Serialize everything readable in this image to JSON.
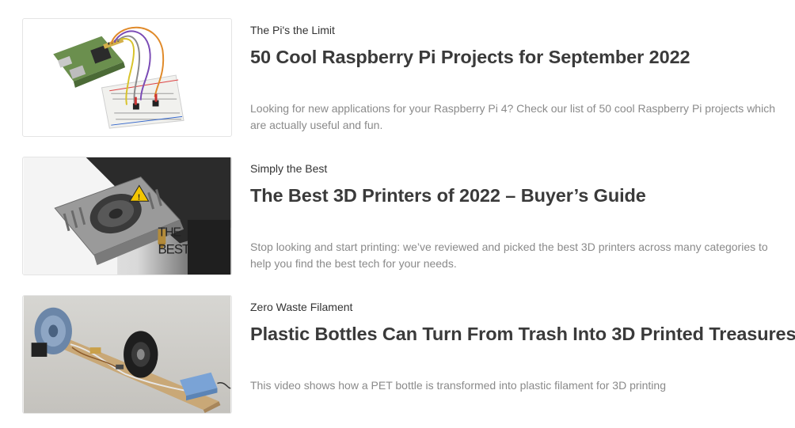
{
  "articles": [
    {
      "kicker": "The Pi's the Limit",
      "title": "50 Cool Raspberry Pi Projects for September 2022",
      "excerpt": "Looking for new applications for your Raspberry Pi 4? Check our list of 50 cool Raspberry Pi projects which are actually useful and fun.",
      "image": "raspberry-pi-breadboard-image"
    },
    {
      "kicker": "Simply the Best",
      "title": "The Best 3D Printers of 2022 – Buyer’s Guide",
      "excerpt": "Stop looking and start printing: we’ve reviewed and picked the best 3D printers across many categories to help you find the best tech for your needs.",
      "image": "3d-printer-hotend-image",
      "image_overlay_text": "THE BEST"
    },
    {
      "kicker": "Zero Waste Filament",
      "title": "Plastic Bottles Can Turn From Trash Into 3D Printed Treasures",
      "excerpt": "This video shows how a PET bottle is transformed into plastic filament for 3D printing",
      "image": "pet-bottle-filament-machine-image"
    }
  ]
}
